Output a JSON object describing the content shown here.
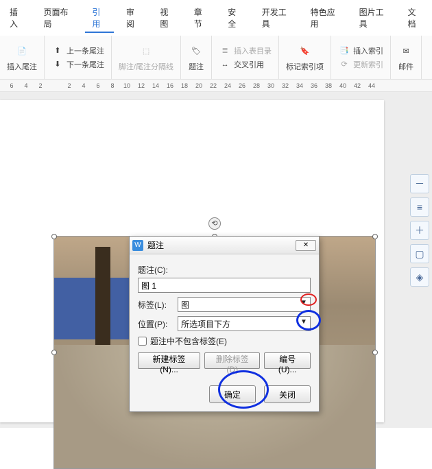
{
  "ribbon": {
    "tabs": [
      "插入",
      "页面布局",
      "引用",
      "审阅",
      "视图",
      "章节",
      "安全",
      "开发工具",
      "特色应用",
      "图片工具",
      "文档"
    ],
    "active": "引用",
    "groups": {
      "footnote": {
        "insert": "插入尾注",
        "prev": "上一条尾注",
        "next": "下一条尾注",
        "sep": "脚注/尾注分隔线"
      },
      "caption": {
        "label": "题注",
        "tof": "插入表目录",
        "xref": "交叉引用"
      },
      "index": {
        "mark": "标记索引项",
        "insert": "插入索引",
        "update": "更新索引"
      },
      "mail": {
        "label": "邮件"
      }
    }
  },
  "ruler": [
    6,
    4,
    2,
    "",
    2,
    4,
    6,
    8,
    10,
    12,
    14,
    16,
    18,
    20,
    22,
    24,
    26,
    28,
    30,
    32,
    34,
    36,
    38,
    40,
    42,
    44
  ],
  "sidebar": {
    "minus": "－",
    "para": "≡",
    "zoom": "＋",
    "crop": "▢",
    "select": "◈"
  },
  "dialog": {
    "title": "题注",
    "caption_label": "题注(C):",
    "caption_value": "图 1",
    "tag_label": "标签(L):",
    "tag_value": "图",
    "pos_label": "位置(P):",
    "pos_value": "所选项目下方",
    "exclude": "题注中不包含标签(E)",
    "new_tag": "新建标签(N)...",
    "del_tag": "删除标签(D)",
    "numbering": "编号(U)...",
    "ok": "确定",
    "cancel": "关闭",
    "close_x": "✕"
  }
}
